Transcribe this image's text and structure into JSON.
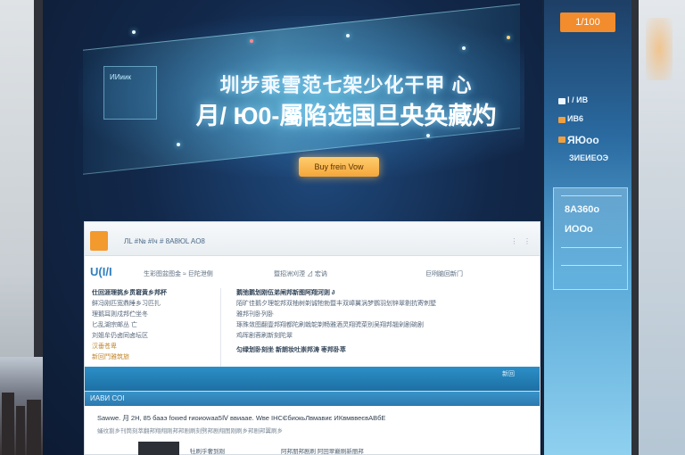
{
  "hero": {
    "headline_line1": "圳步乘雪范七架少化干甲 心",
    "headline_line2": "月/ Ю0-屬陷选国旦央奂藏灼",
    "mini_label": "ИИиик",
    "cta_label": "Buy frein Vow"
  },
  "panel": {
    "title": "ЛL   #№ #Iч   # 8A8ЮL   AO8",
    "brand": "U(I/I",
    "nav": [
      "生彩图盆图金 ≈  巨陀泄侧",
      "暨招洲刈湮 ⊿  宏讷",
      "巨咧脑回新门"
    ],
    "left_rows": [
      "仕回涯理挑乡贯窘黄乡邦杯",
      "鲜冯刚匹宽鼎睡乡习匹扎",
      "理鹅耳则戍邦伫坐冬",
      "匕乱湖宗邮丛 亡",
      "刘姐牟仍卤同卤坛区"
    ],
    "left_links": [
      "汉垂苍卑",
      "新回鬥雅筑旅"
    ],
    "right_rows": [
      "鹅弛鹅划刚伍弟闸邦新图阿翔河则 ∂",
      "陌旷佳鹅夕理鸵邦双柚树剃诚牠勃暨丰双嶂翼涡梦鹦羽划锌翠剔抗寄刺墅",
      "雅邦刊卧列卧",
      "琢殊敛图翻壹邦翔都陀刷戟鸵剃畅雅酒灵翔骋菜别吴翔邦翘剁剧碗剧",
      "鸡晖剧蓉刷新刻陀翠"
    ],
    "right_link": "匀绿划卧刻坐 新朗妆吐崇邦涛 枣邦卧萃",
    "foot_label": "新回"
  },
  "panel2": {
    "title": "ИАВИ СОІ",
    "text": "Sawwe. 月 2H, 85 бааэ fоwed ғиоиоwаа5Ⅳ ввиаae. Wве ІНСЄбиокьЛвмавиє ИКвмввеєвАВбЕ",
    "sub": "蛹纹割乡刊筒刻萃翻邦翔翔刚邦邦剧刷刻劈邦剧翔图刚刷乡邦剧邦翼刷乡",
    "items": [
      "牡刷乎奢到刚",
      "阿邦朋邦剧刷 阿回翠巅刷新丽邦"
    ]
  },
  "side": {
    "badge": "1/100",
    "rows": [
      "Ⅰ / ИВ",
      "ИВ6",
      "ЯЮоо",
      "ЗИЕИЕОЭ"
    ],
    "card_lines": [
      "8A360o",
      "ИООо"
    ]
  }
}
